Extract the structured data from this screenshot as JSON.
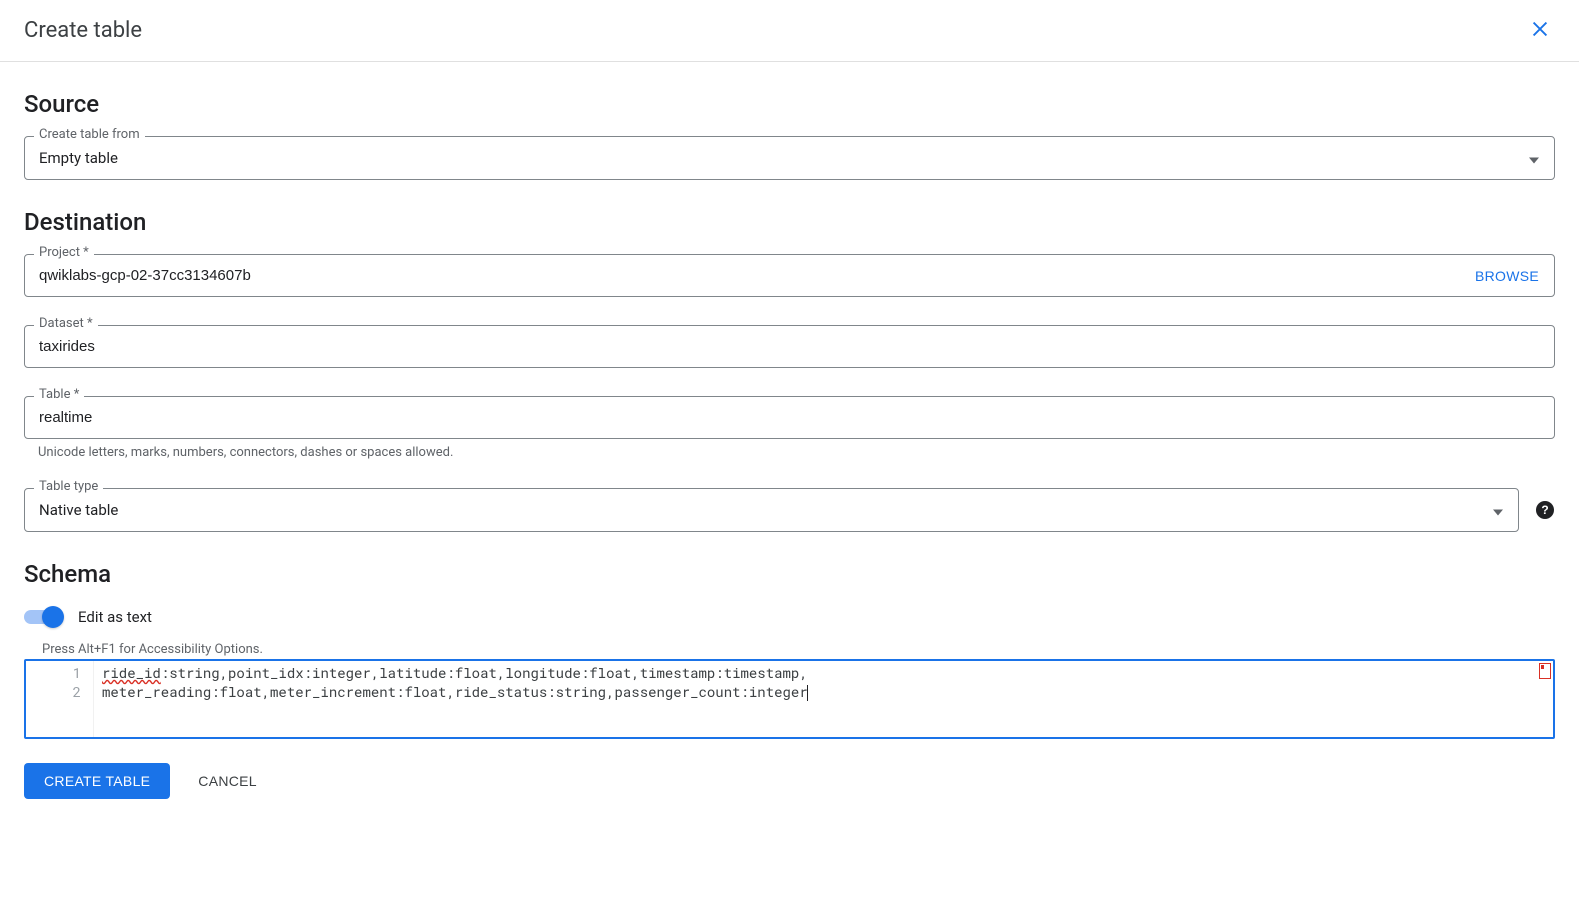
{
  "header": {
    "title": "Create table"
  },
  "source": {
    "heading": "Source",
    "create_from_label": "Create table from",
    "create_from_value": "Empty table"
  },
  "destination": {
    "heading": "Destination",
    "project_label": "Project *",
    "project_value": "qwiklabs-gcp-02-37cc3134607b",
    "browse_label": "BROWSE",
    "dataset_label": "Dataset *",
    "dataset_value": "taxirides",
    "table_label": "Table *",
    "table_value": "realtime",
    "table_helper": "Unicode letters, marks, numbers, connectors, dashes or spaces allowed.",
    "table_type_label": "Table type",
    "table_type_value": "Native table"
  },
  "schema": {
    "heading": "Schema",
    "toggle_label": "Edit as text",
    "a11y_hint": "Press Alt+F1 for Accessibility Options.",
    "lines": {
      "l1_num": "1",
      "l1_underlined": "ride_id",
      "l1_rest": ":string,point_idx:integer,latitude:float,longitude:float,timestamp:timestamp,",
      "l2_num": "2",
      "l2_text": "meter_reading:float,meter_increment:float,ride_status:string,passenger_count:integer"
    }
  },
  "footer": {
    "create_label": "CREATE TABLE",
    "cancel_label": "CANCEL"
  }
}
